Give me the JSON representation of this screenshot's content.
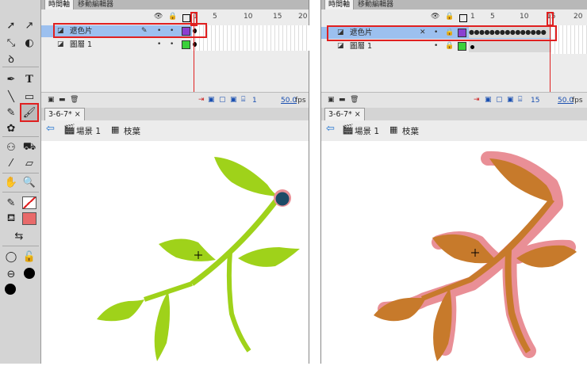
{
  "tools": {
    "select_icon": "arrow-icon",
    "pen_icon": "pen-icon",
    "text_glyph": "T",
    "brush_icon": "brush-icon"
  },
  "left": {
    "tabs": [
      "時間軸",
      "移動編輯器"
    ],
    "ruler": [
      "1",
      "5",
      "10",
      "15",
      "20"
    ],
    "layers": [
      {
        "name": "遮色片",
        "color": "#8a3fd1",
        "selected": true
      },
      {
        "name": "圖層 1",
        "color": "#3ad03a",
        "selected": false
      }
    ],
    "frame_number": "1",
    "fps": "50.0",
    "fps_unit": "fps",
    "doc_tab": "3-6-7*",
    "close": "×",
    "scene": "場景 1",
    "symbol": "枝葉"
  },
  "right": {
    "tabs": [
      "時間軸",
      "移動編輯器"
    ],
    "ruler": [
      "1",
      "5",
      "10",
      "15",
      "20"
    ],
    "layers": [
      {
        "name": "遮色片",
        "color": "#8a3fd1",
        "selected": true
      },
      {
        "name": "圖層 1",
        "color": "#3ad03a",
        "selected": false
      }
    ],
    "frame_number": "15",
    "fps": "50.0",
    "fps_unit": "fps",
    "doc_tab": "3-6-7*",
    "close": "×",
    "scene": "場景 1",
    "symbol": "枝葉"
  },
  "colors": {
    "highlight": "#e02020",
    "leaf_green": "#9fd21a",
    "mask_orange": "#c77a2b",
    "mask_pink": "#e98f96"
  }
}
